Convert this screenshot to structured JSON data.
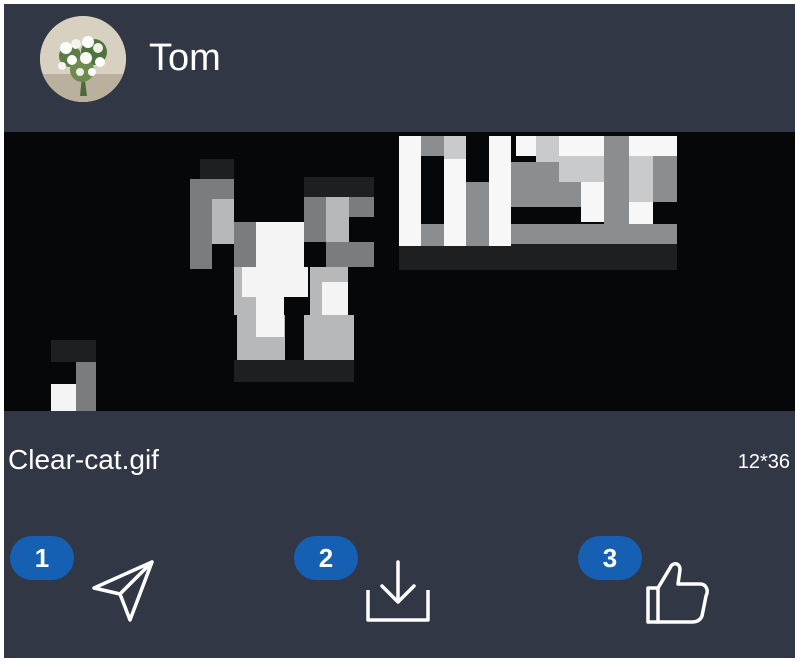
{
  "post": {
    "username": "Tom",
    "avatar_icon": "flower-bouquet-avatar",
    "file_name": "Clear-cat.gif",
    "file_size": "12*36"
  },
  "actions": [
    {
      "badge": "1",
      "icon": "send-icon"
    },
    {
      "badge": "2",
      "icon": "download-icon"
    },
    {
      "badge": "3",
      "icon": "thumbs-up-icon"
    }
  ],
  "colors": {
    "card_background": "#323745",
    "image_background": "#050709",
    "badge": "#1660b4",
    "text": "#ffffff"
  }
}
